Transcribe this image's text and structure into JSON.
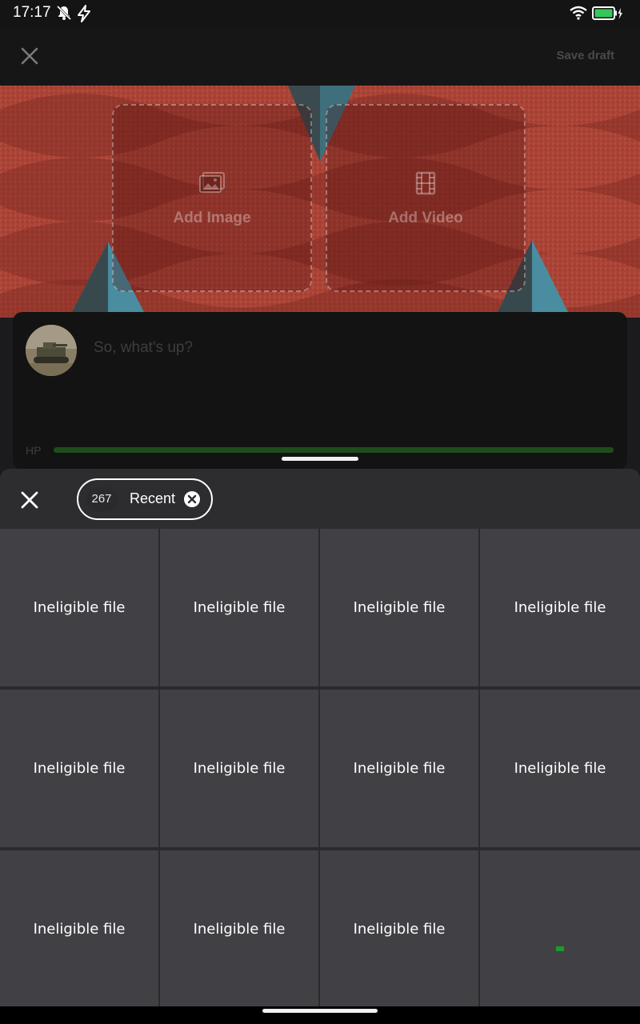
{
  "status_bar": {
    "time": "17:17",
    "icons": [
      "mute-icon",
      "charging-bolt-icon",
      "wifi-icon",
      "battery-icon"
    ]
  },
  "header": {
    "close_icon": "close-icon",
    "save_draft_label": "Save draft"
  },
  "media": {
    "add_image_label": "Add Image",
    "add_video_label": "Add Video",
    "image_icon": "image-icon",
    "video_icon": "film-icon"
  },
  "compose": {
    "placeholder": "So, what's up?",
    "hp_label": "HP",
    "hp_progress": 1.0
  },
  "picker": {
    "close_icon": "close-icon",
    "filter_chip": {
      "count": "267",
      "label": "Recent",
      "clear_icon": "clear-circle-icon"
    },
    "cells": [
      {
        "label": "Ineligible file"
      },
      {
        "label": "Ineligible file"
      },
      {
        "label": "Ineligible file"
      },
      {
        "label": "Ineligible file"
      },
      {
        "label": "Ineligible file"
      },
      {
        "label": "Ineligible file"
      },
      {
        "label": "Ineligible file"
      },
      {
        "label": "Ineligible file"
      },
      {
        "label": "Ineligible file"
      },
      {
        "label": "Ineligible file"
      },
      {
        "label": "Ineligible file"
      },
      {
        "label": ""
      }
    ]
  },
  "colors": {
    "background_art": "#b5493c",
    "hp_bar": "#1e4d1c",
    "battery": "#34c759"
  }
}
